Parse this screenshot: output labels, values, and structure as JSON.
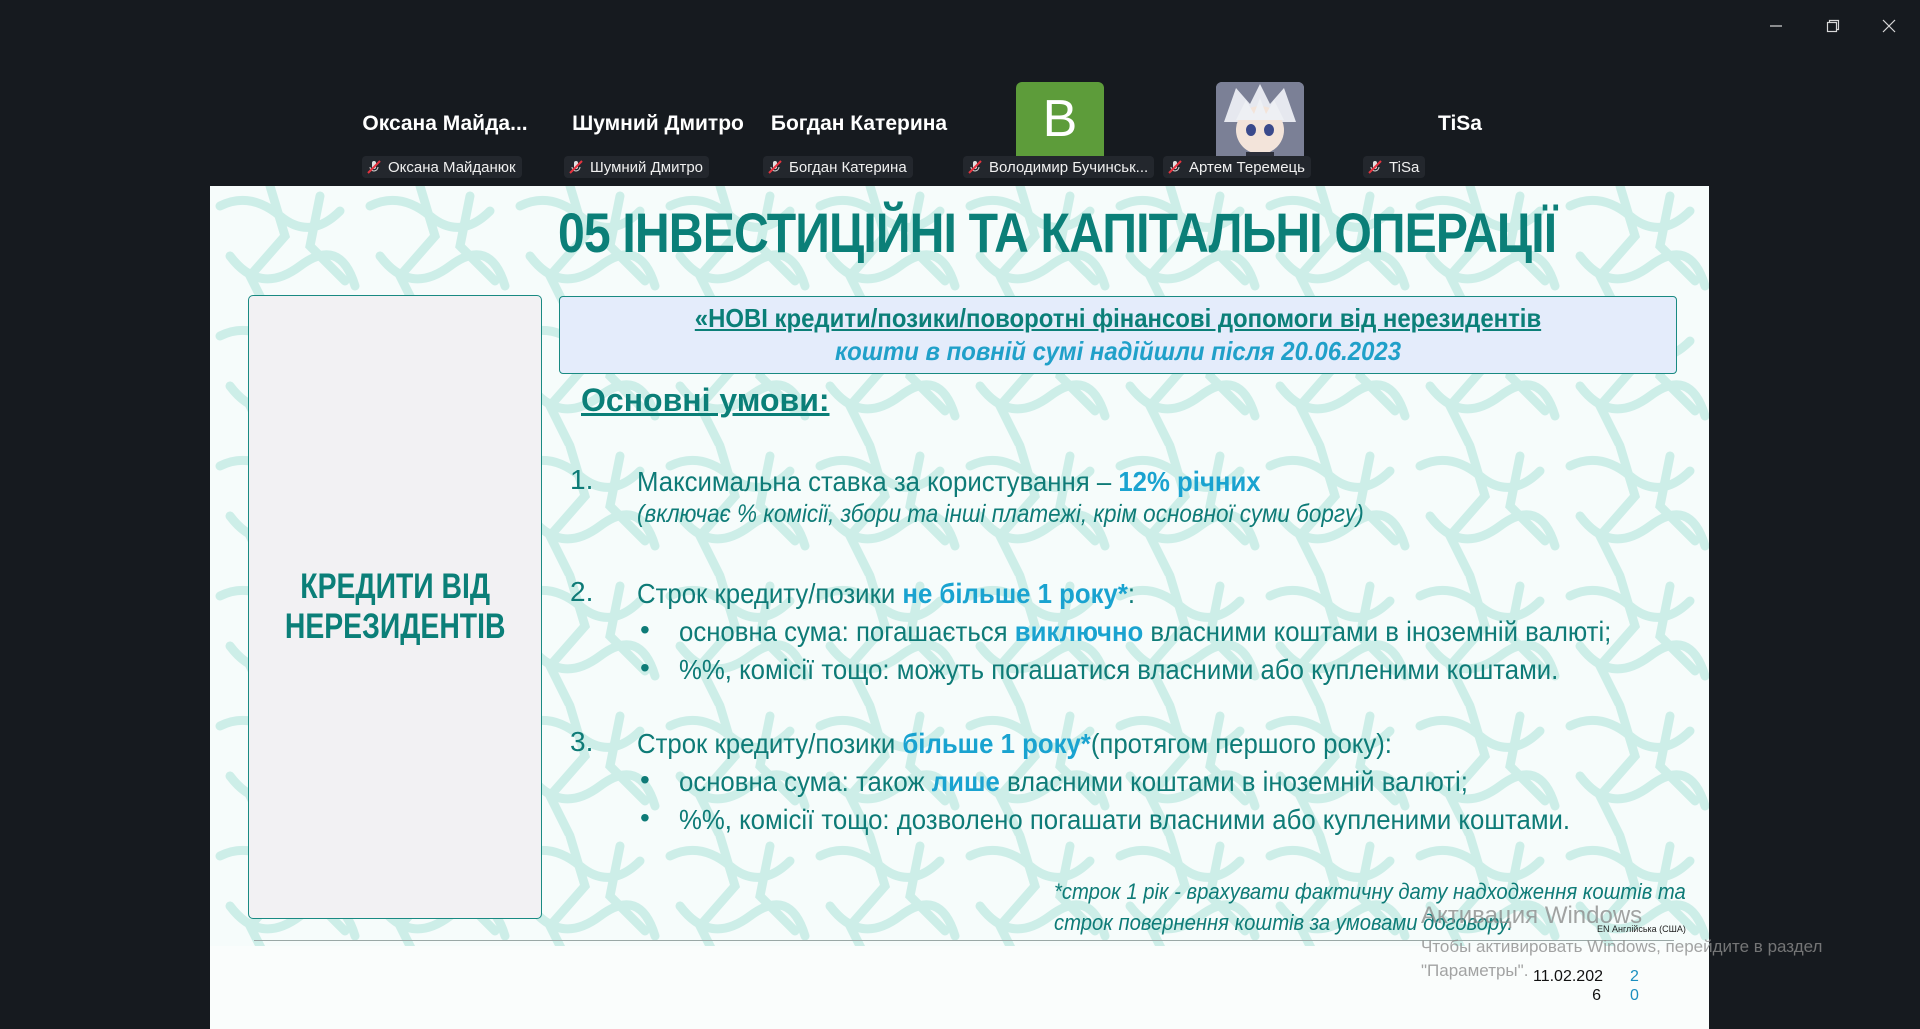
{
  "participants": [
    {
      "tile_name": "Оксана  Майда...",
      "tag": "Оксана Майданюк",
      "avatar": "none"
    },
    {
      "tile_name": "Шумний Дмитро",
      "tag": "Шумний Дмитро",
      "avatar": "none"
    },
    {
      "tile_name": "Богдан Катерина",
      "tag": "Богдан Катерина",
      "avatar": "none"
    },
    {
      "tile_name": "",
      "tag": "Володимир Бучинськ...",
      "avatar": "letter",
      "letter": "B",
      "color": "#5d9c3a"
    },
    {
      "tile_name": "",
      "tag": "Артем Теремець",
      "avatar": "image"
    },
    {
      "tile_name": "TiSa",
      "tag": "TiSa",
      "avatar": "none"
    }
  ],
  "slide": {
    "title": "05 ІНВЕСТИЦІЙНІ ТА КАПІТАЛЬНІ ОПЕРАЦІЇ",
    "side_label_1": "КРЕДИТИ ВІД",
    "side_label_2": "НЕРЕЗИДЕНТІВ",
    "banner_line1": "«НОВІ кредити/позики/поворотні фінансові допомоги від нерезидентів",
    "banner_line2": "кошти в повній сумі надійшли після 20.06.2023",
    "subheading": "Основні умови:",
    "items": {
      "i1_num": "1.",
      "i1_text": "Максимальна ставка за користування – ",
      "i1_hl": "12% річних",
      "i1_note": "(включає % комісії, збори та інші платежі, крім основної суми боргу)",
      "i2_num": "2.",
      "i2_text": "Строк кредиту/позики ",
      "i2_hl": "не більше 1 року*",
      "i2_tail": ":",
      "i2_b1_pre": "основна сума: погашається ",
      "i2_b1_hl": "виключно",
      "i2_b1_post": " власними коштами в іноземній валюті;",
      "i2_b2": "%%, комісії тощо: можуть погашатися власними або купленими коштами.",
      "i3_num": "3.",
      "i3_text": "Строк кредиту/позики ",
      "i3_hl": "більше 1 року*",
      "i3_tail": "(протягом першого року):",
      "i3_b1_pre": "основна сума: також ",
      "i3_b1_hl": "лише",
      "i3_b1_post": " власними коштами в іноземній валюті;",
      "i3_b2": "%%, комісії тощо: дозволено погашати власними або купленими коштами."
    },
    "bullet_char": "•",
    "footnote_1": "*строк 1 рік - врахувати фактичну дату надходження коштів та",
    "footnote_2": "строк повернення коштів за умовами договору.",
    "date_1": "11.02.202",
    "date_2": "6",
    "page_1": "2",
    "page_2": "0"
  },
  "overlay": {
    "activation_title": "Активация Windows",
    "activation_line1": "Чтобы активировать Windows, перейдите в раздел",
    "activation_line2": "\"Параметры\".",
    "lang": "EN Англійська (США)"
  },
  "colors": {
    "accent": "#0b7f78",
    "highlight": "#1aa3d0",
    "banner": "#e4ecfb"
  }
}
